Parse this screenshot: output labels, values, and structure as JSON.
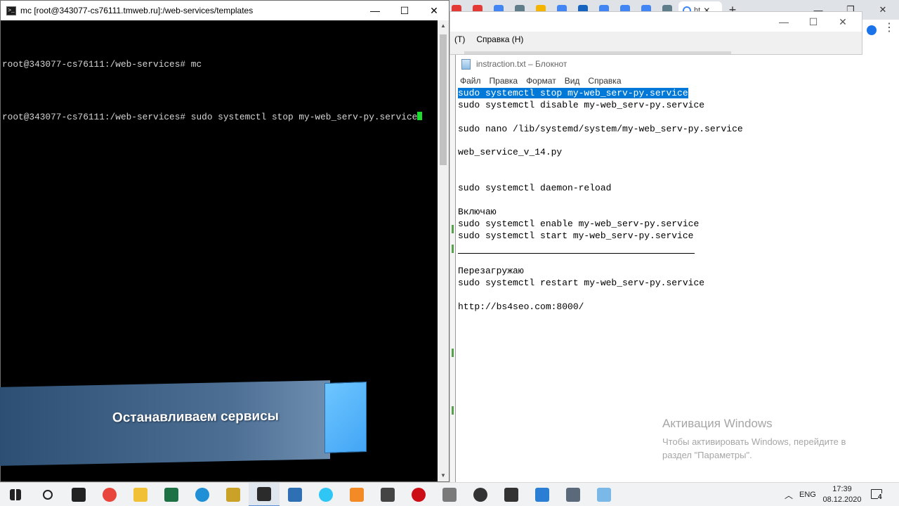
{
  "terminal": {
    "title": "mc [root@343077-cs76111.tmweb.ru]:/web-services/templates",
    "lines": [
      "root@343077-cs76111:/web-services# mc",
      "root@343077-cs76111:/web-services# sudo systemctl stop my-web_serv-py.service"
    ]
  },
  "caption": {
    "text": "Останавливаем сервисы"
  },
  "midwindow": {
    "menu": [
      "(Т)",
      "Справка (Н)"
    ]
  },
  "notepad": {
    "title": "instraction.txt – Блокнот",
    "menu": [
      "Файл",
      "Правка",
      "Формат",
      "Вид",
      "Справка"
    ],
    "lines": [
      "sudo systemctl stop my-web_serv-py.service",
      "sudo systemctl disable my-web_serv-py.service",
      "",
      "sudo nano /lib/systemd/system/my-web_serv-py.service",
      "",
      "web_service_v_14.py",
      "",
      "",
      "sudo systemctl daemon-reload",
      "",
      "Включаю",
      "sudo systemctl enable my-web_serv-py.service",
      "sudo systemctl start my-web_serv-py.service",
      "",
      "",
      "Перезагружаю",
      "sudo systemctl restart my-web_serv-py.service",
      "",
      "http://bs4seo.com:8000/"
    ],
    "selected_line": 0
  },
  "activation": {
    "title": "Активация Windows",
    "text": "Чтобы активировать Windows, перейдите в раздел \"Параметры\"."
  },
  "browser": {
    "tab_colors": [
      "#e53935",
      "#e53935",
      "#4285f4",
      "#607d8b",
      "#f4b400",
      "#4285f4",
      "#1565c0",
      "#4285f4",
      "#4285f4",
      "#4285f4",
      "#607d8b"
    ],
    "active_tab_label": "ht"
  },
  "taskbar": {
    "icons": [
      "windows-start-icon",
      "search-icon",
      "task-view-icon",
      "chrome-icon",
      "file-explorer-icon",
      "excel-icon",
      "edge-icon",
      "file-manager-icon",
      "putty-icon",
      "network-tool-icon",
      "bitrix24-icon",
      "sublime-text-icon",
      "window-app-icon",
      "opera-icon",
      "database-icon",
      "obs-icon",
      "settings-icon",
      "remote-desktop-icon",
      "network-drive-icon",
      "notepad-icon"
    ],
    "language": "ENG",
    "time": "17:39",
    "date": "08.12.2020",
    "notifications": "4"
  }
}
